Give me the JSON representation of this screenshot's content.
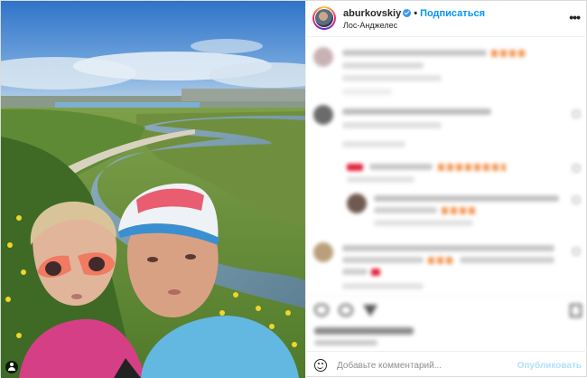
{
  "post": {
    "username": "aburkovskiy",
    "separator": "•",
    "follow_label": "Подписаться",
    "location": "Лос-Анджелес",
    "more_label": "•••"
  },
  "composer": {
    "placeholder": "Добавьте комментарий...",
    "publish_label": "Опубликовать"
  },
  "icons": {
    "verified": "verified-badge-icon",
    "more": "more-options-icon",
    "emoji": "emoji-smile-icon",
    "tagged_user": "user-tag-icon",
    "like": "heart-icon"
  },
  "colors": {
    "accent": "#0095f6",
    "publish_disabled": "#b2dffc",
    "verified": "#3897f0",
    "text": "#262626",
    "secondary": "#8e8e8e"
  }
}
